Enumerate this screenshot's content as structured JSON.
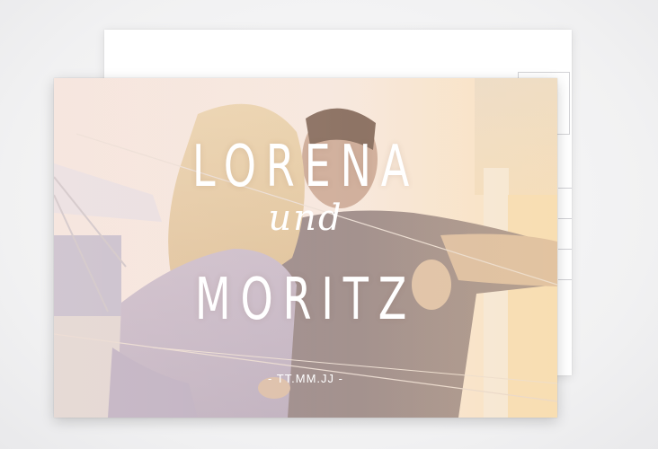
{
  "card": {
    "name_top": "LORENA",
    "connector": "und",
    "name_bottom": "MORITZ",
    "date_line": "- TT.MM.JJ -"
  },
  "colors": {
    "background": "#f1f1f2",
    "back_card": "#ffffff",
    "text": "#ffffff",
    "photo_tint": "#f5e6d8"
  }
}
